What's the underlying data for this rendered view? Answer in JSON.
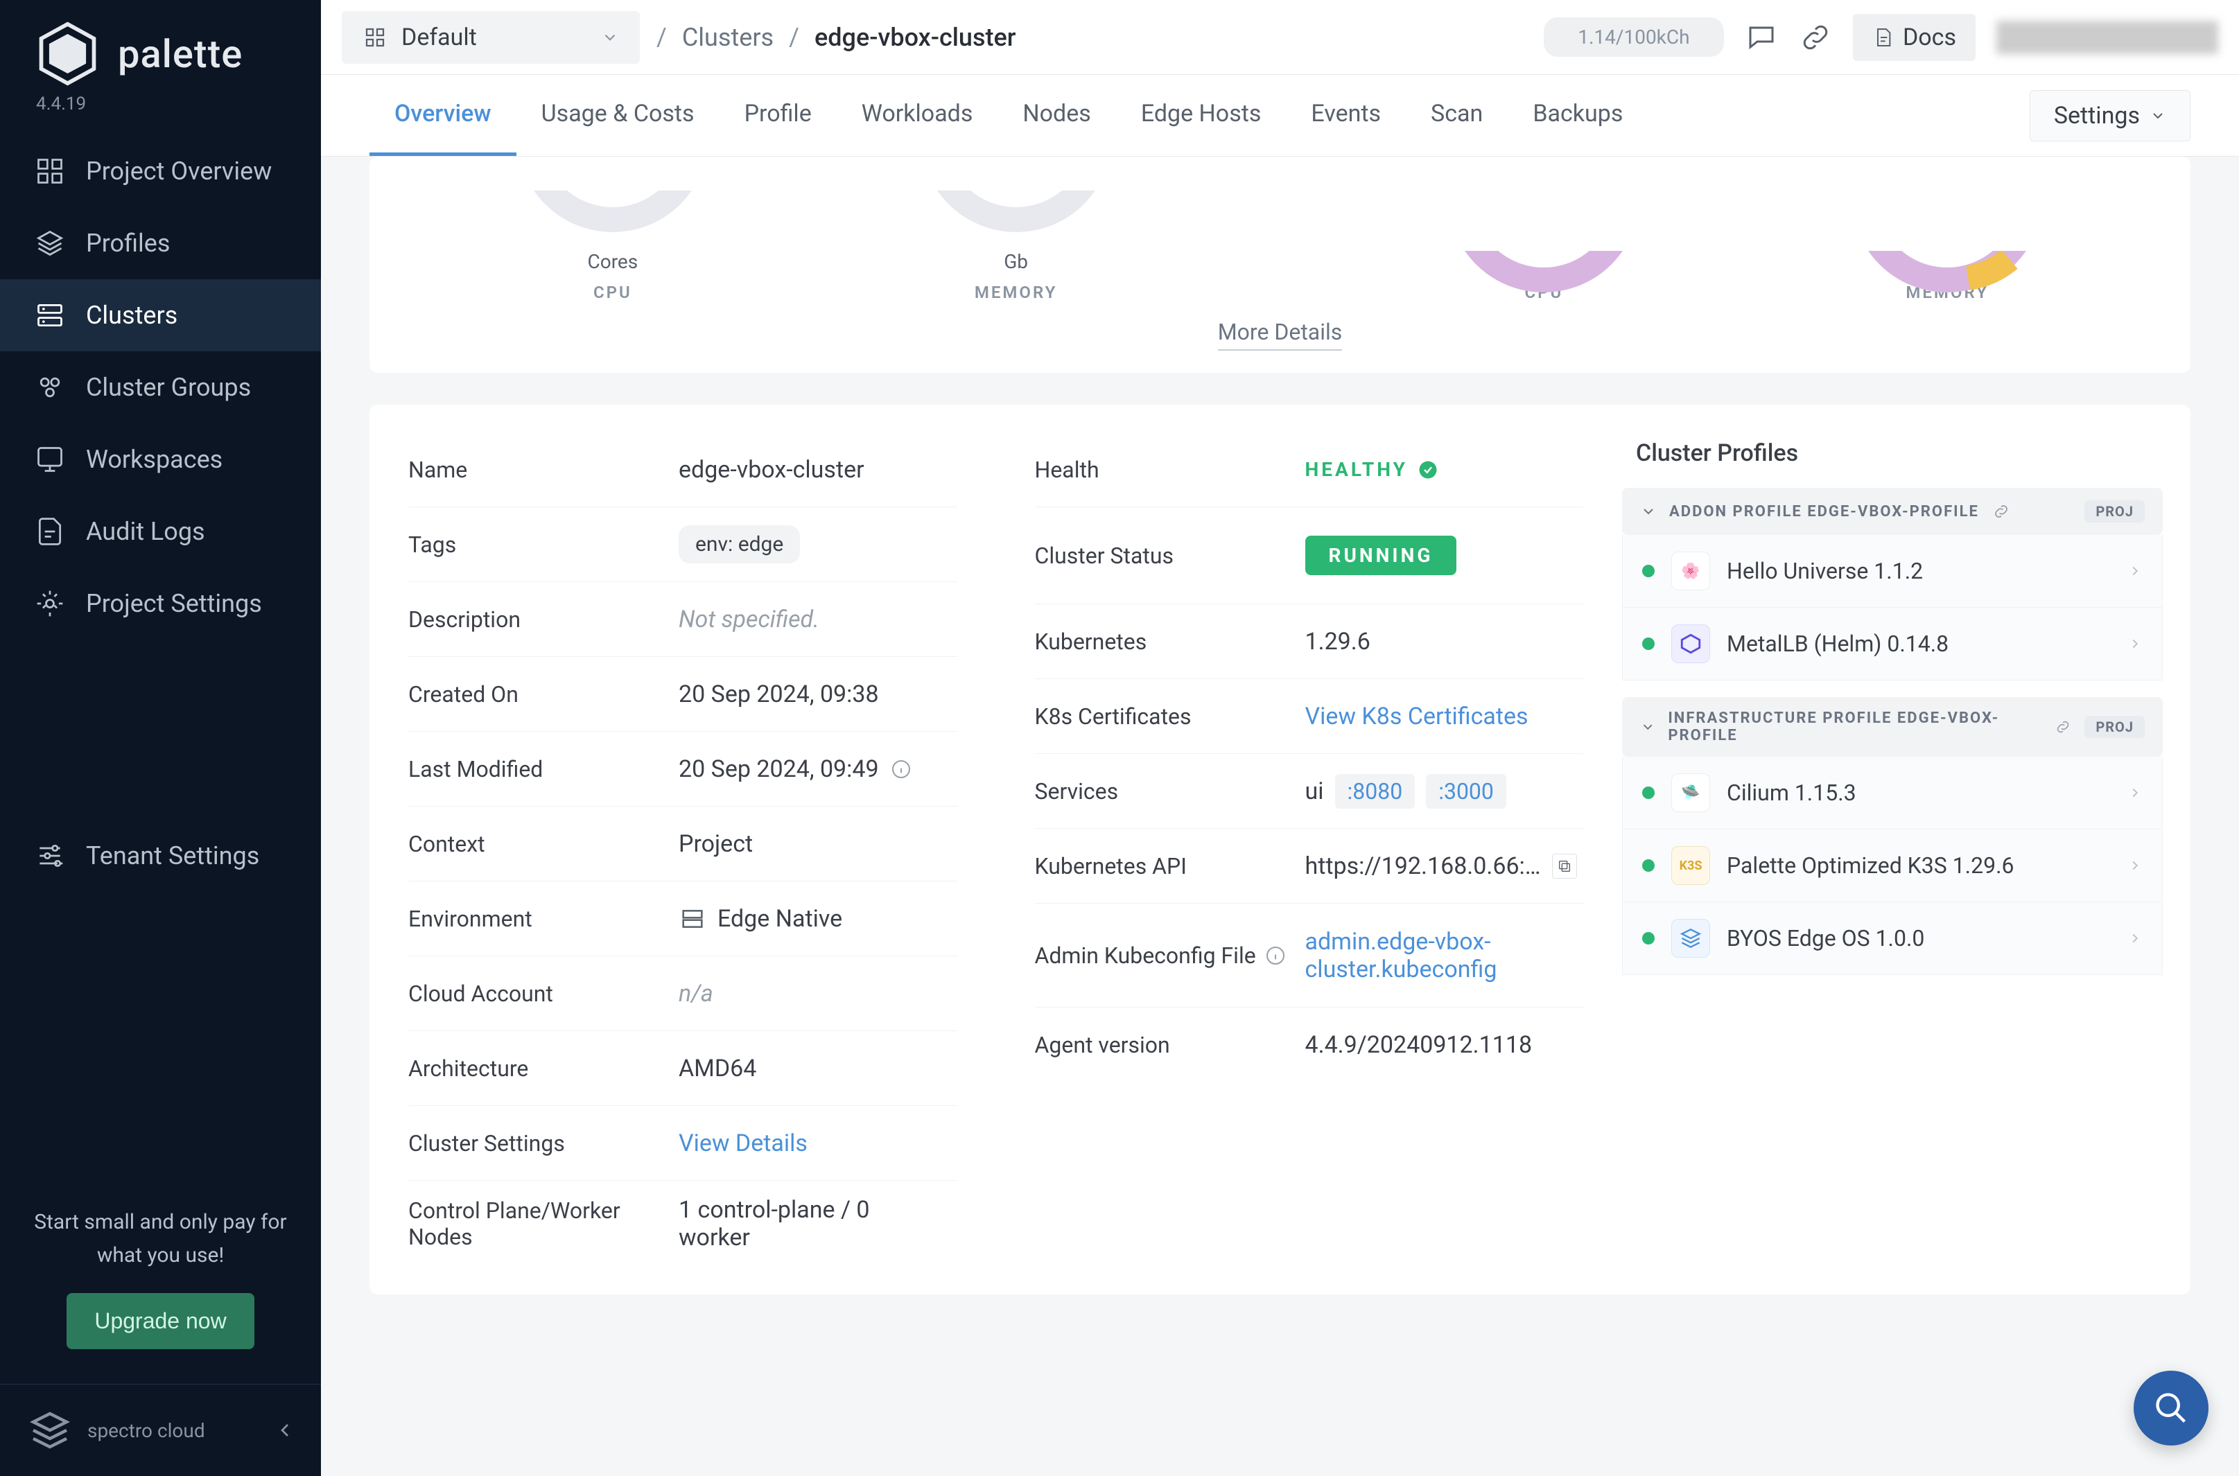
{
  "brand": {
    "name": "palette",
    "version": "4.4.19"
  },
  "sidebar": {
    "items": [
      {
        "label": "Project Overview"
      },
      {
        "label": "Profiles"
      },
      {
        "label": "Clusters"
      },
      {
        "label": "Cluster Groups"
      },
      {
        "label": "Workspaces"
      },
      {
        "label": "Audit Logs"
      },
      {
        "label": "Project Settings"
      }
    ],
    "tenant_settings": "Tenant Settings",
    "trial_text": "Start small and only pay for what you use!",
    "upgrade": "Upgrade now",
    "footer_brand": "spectro cloud"
  },
  "topbar": {
    "project_selector": "Default",
    "breadcrumb": {
      "parent": "Clusters",
      "current": "edge-vbox-cluster"
    },
    "search_placeholder": "1.14/100kCh",
    "docs": "Docs"
  },
  "tabs": {
    "items": [
      "Overview",
      "Usage & Costs",
      "Profile",
      "Workloads",
      "Nodes",
      "Edge Hosts",
      "Events",
      "Scan",
      "Backups"
    ],
    "settings": "Settings"
  },
  "gauges": {
    "cpu_left": {
      "value": "Cores",
      "label": "CPU"
    },
    "memory_left": {
      "value": "Gb",
      "label": "MEMORY"
    },
    "cpu_right": {
      "label": "CPU"
    },
    "memory_right": {
      "label": "MEMORY"
    },
    "more": "More Details"
  },
  "details_left": {
    "name_label": "Name",
    "name_value": "edge-vbox-cluster",
    "tags_label": "Tags",
    "tag_chip": "env: edge",
    "description_label": "Description",
    "description_value": "Not specified.",
    "created_label": "Created On",
    "created_value": "20 Sep 2024, 09:38",
    "modified_label": "Last Modified",
    "modified_value": "20 Sep 2024, 09:49",
    "context_label": "Context",
    "context_value": "Project",
    "env_label": "Environment",
    "env_value": "Edge Native",
    "cloud_label": "Cloud Account",
    "cloud_value": "n/a",
    "arch_label": "Architecture",
    "arch_value": "AMD64",
    "settings_label": "Cluster Settings",
    "settings_value": "View Details",
    "cp_label": "Control Plane/Worker Nodes",
    "cp_value": "1 control-plane / 0 worker"
  },
  "details_right": {
    "health_label": "Health",
    "health_value": "HEALTHY",
    "status_label": "Cluster Status",
    "status_value": "RUNNING",
    "k8s_label": "Kubernetes",
    "k8s_value": "1.29.6",
    "certs_label": "K8s Certificates",
    "certs_value": "View K8s Certificates",
    "services_label": "Services",
    "services_ui": "ui",
    "services_p1": ":8080",
    "services_p2": ":3000",
    "api_label": "Kubernetes API",
    "api_value": "https://192.168.0.66:…",
    "kubeconfig_label": "Admin Kubeconfig File",
    "kubeconfig_value": "admin.edge-vbox-cluster.kubeconfig",
    "agent_label": "Agent version",
    "agent_value": "4.4.9/20240912.1118"
  },
  "profiles": {
    "title": "Cluster Profiles",
    "addon_header": "ADDON PROFILE EDGE-VBOX-PROFILE",
    "addon_scope": "PROJ",
    "addon_layers": [
      {
        "name": "Hello Universe 1.1.2",
        "icon_bg": "#fff",
        "icon_fg": "#2bb673"
      },
      {
        "name": "MetalLB (Helm) 0.14.8",
        "icon_bg": "#eef",
        "icon_fg": "#5a4ad9"
      }
    ],
    "infra_header": "INFRASTRUCTURE PROFILE EDGE-VBOX-PROFILE",
    "infra_scope": "PROJ",
    "infra_layers": [
      {
        "name": "Cilium 1.15.3",
        "icon_bg": "#fff",
        "icon_fg": "#f08a2a"
      },
      {
        "name": "Palette Optimized K3S 1.29.6",
        "icon_bg": "#fff8e8",
        "icon_fg": "#d9a82b",
        "icon_text": "K3S"
      },
      {
        "name": "BYOS Edge OS 1.0.0",
        "icon_bg": "#eef5ff",
        "icon_fg": "#4a90d9"
      }
    ]
  }
}
